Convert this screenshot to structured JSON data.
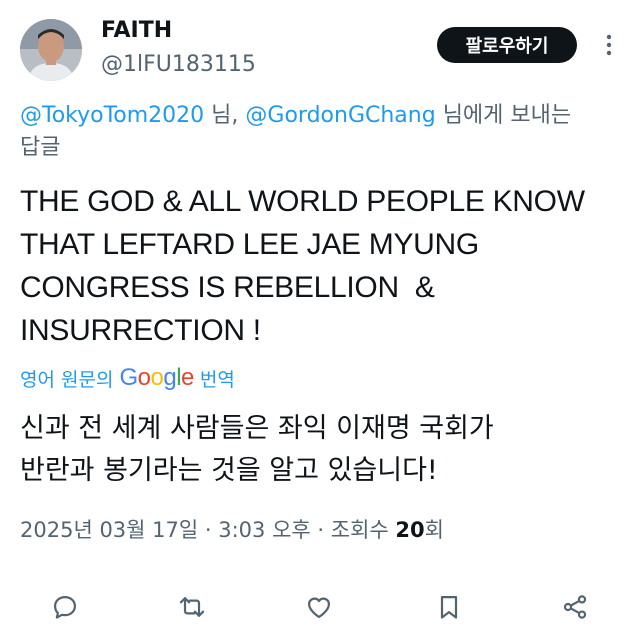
{
  "author": {
    "name": "FAITH",
    "handle": "@1lFU183115"
  },
  "follow_button": {
    "label": "팔로우하기"
  },
  "reply_context": {
    "mention_1": "@TokyoTom2020",
    "suffix_1": " 님, ",
    "mention_2": "@GordonGChang",
    "suffix_2": " 님에게 보내는",
    "line_2": "답글"
  },
  "tweet": {
    "lines": [
      "THE GOD & ALL WORLD PEOPLE KNOW",
      "THAT LEFTARD LEE JAE MYUNG",
      "CONGRESS IS REBELLION  &",
      "INSURRECTION !"
    ]
  },
  "translation": {
    "prefix": "영어 원문의",
    "google_letters": [
      "G",
      "o",
      "o",
      "g",
      "l",
      "e"
    ],
    "suffix": "번역",
    "lines": [
      "신과 전 세계 사람들은 좌익 이재명 국회가",
      "반란과 봉기라는 것을 알고 있습니다!"
    ]
  },
  "meta": {
    "date": "2025년 03월 17일",
    "separator_1": " · ",
    "time": "3:03 오후",
    "separator_2": " · ",
    "views_label": "조회수 ",
    "views_count": "20",
    "views_unit": "회"
  },
  "colors": {
    "accent": "#1d9bf0",
    "text": "#0f1419",
    "secondary": "#536471",
    "button_bg": "#0f1419"
  },
  "icons": [
    "more-icon",
    "reply-icon",
    "retweet-icon",
    "like-icon",
    "bookmark-icon",
    "share-icon"
  ]
}
